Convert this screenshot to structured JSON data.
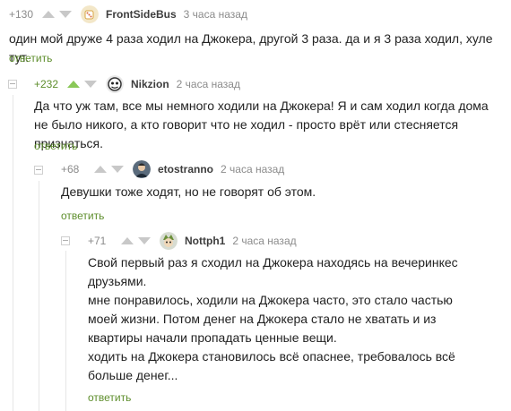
{
  "comments": [
    {
      "rating": "+130",
      "user": "FrontSideBus",
      "time": "3 часа назад",
      "body": "один мой друже 4 раза ходил на Джокера, другой 3 раза. да и я 3 раза ходил, хуле тут.",
      "reply": "ответить",
      "avatar_icon": "dice-avatar-icon"
    },
    {
      "rating": "+232",
      "user": "Nikzion",
      "time": "2 часа назад",
      "body": "Да что уж там, все мы немного ходили на Джокера! Я и сам ходил когда дома не было никого, а кто говорит что не ходил - просто врёт или стесняется признаться.",
      "reply": "ответить",
      "avatar_icon": "face-avatar-icon",
      "upvoted": true
    },
    {
      "rating": "+68",
      "user": "etostranno",
      "time": "2 часа назад",
      "body": "Девушки тоже ходят, но не говорят об этом.",
      "reply": "ответить",
      "avatar_icon": "portrait-avatar-icon"
    },
    {
      "rating": "+71",
      "user": "Nottph1",
      "time": "2 часа назад",
      "body_lines": [
        "Свой первый раз я сходил на Джокера находясь на вечеринкес друзьями.",
        "мне понравилось, ходили на Джокера часто, это стало частью моей жизни. Потом денег на Джокера стало не хватать и из квартиры начали пропадать ценные вещи.",
        "ходить на Джокера становилось всё опаснее, требовалось всё больше денег..."
      ],
      "reply": "ответить",
      "avatar_icon": "character-avatar-icon"
    }
  ],
  "colors": {
    "accent_green": "#5e8e2c",
    "upvote_active": "#8ac858",
    "meta_gray": "#8b8b8b"
  }
}
